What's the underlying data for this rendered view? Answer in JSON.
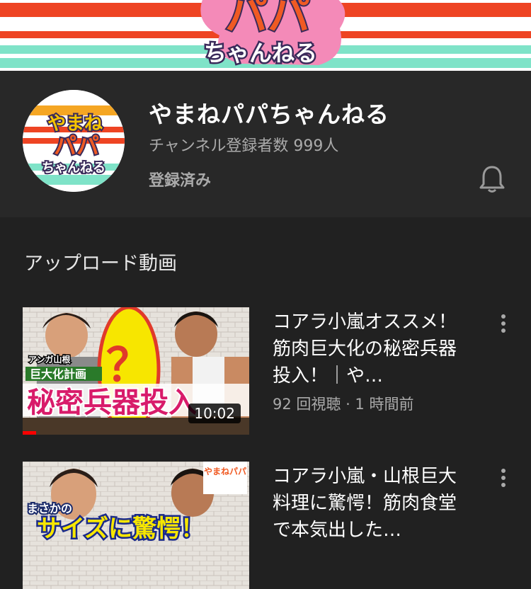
{
  "banner": {
    "logo_text_main": "パパ",
    "logo_text_sub": "ちゃんねる"
  },
  "channel": {
    "name": "やまねパパちゃんねる",
    "subscriber_count": "チャンネル登録者数 999人",
    "subscribed_label": "登録済み",
    "avatar_text_top": "やまね",
    "avatar_text_mid": "パパ",
    "avatar_text_bottom": "ちゃんねる"
  },
  "uploads": {
    "section_title": "アップロード動画",
    "videos": [
      {
        "title": "コアラ小嵐オススメ！筋肉巨大化の秘密兵器投入！｜や…",
        "meta": "92 回視聴 · 1 時間前",
        "duration": "10:02",
        "progress": 0.06,
        "thumb_text_small": "アンガ山根",
        "thumb_text_band": "巨大化計画",
        "thumb_text_big": "秘密兵器投入",
        "thumb_text_q": "？"
      },
      {
        "title": "コアラ小嵐・山根巨大料理に驚愕！筋肉食堂で本気出した…",
        "meta": "",
        "duration": "",
        "progress": 0,
        "thumb_text_small": "まさかの",
        "thumb_text_big": "サイズに驚愕！",
        "thumb_text_logo": "やまねパパ"
      }
    ]
  },
  "colors": {
    "background": "#212121",
    "header_bg": "#282828",
    "banner_red": "#ee4423",
    "banner_teal": "#7fe3c8",
    "progress": "#ff0000",
    "secondary_text": "#aaaaaa"
  },
  "icons": [
    "bell-icon",
    "more-vert-icon"
  ]
}
